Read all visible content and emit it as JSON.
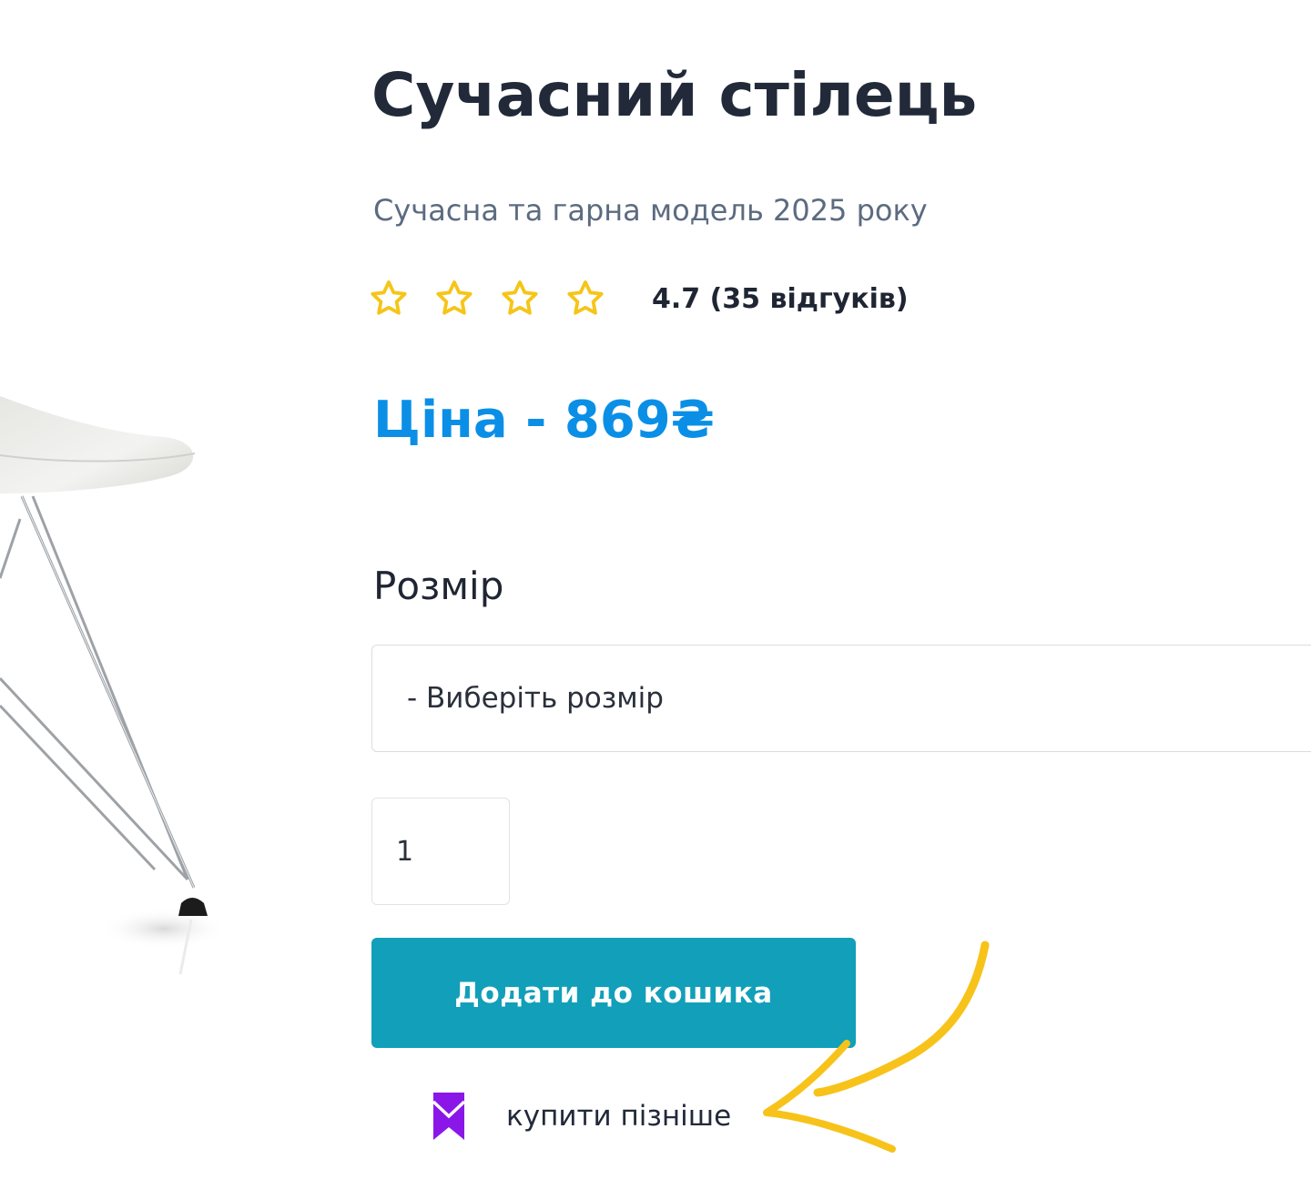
{
  "product": {
    "title": "Сучасний стілець",
    "subtitle": "Сучасна та гарна модель 2025 року",
    "price": "Ціна - 869₴"
  },
  "rating": {
    "stars_shown": 4,
    "text": "4.7 (35 відгуків)",
    "star_color": "#f5c518",
    "star_icon": "star-outline-icon"
  },
  "size": {
    "label": "Розмір",
    "selected": "- Виберіть розмір"
  },
  "quantity": {
    "value": "1"
  },
  "actions": {
    "add_to_cart": "Додати до кошика",
    "buy_later": "купити пізніше",
    "buy_later_icon": "bookmark-icon",
    "button_color": "#129fb9",
    "icon_color": "#8a17e8"
  },
  "annotation": {
    "arrow_color": "#f7c31a",
    "arrow_icon": "hand-drawn-arrow-icon"
  },
  "colors": {
    "title": "#222a3a",
    "subtitle": "#5c6b80",
    "price": "#0b8fe6"
  }
}
